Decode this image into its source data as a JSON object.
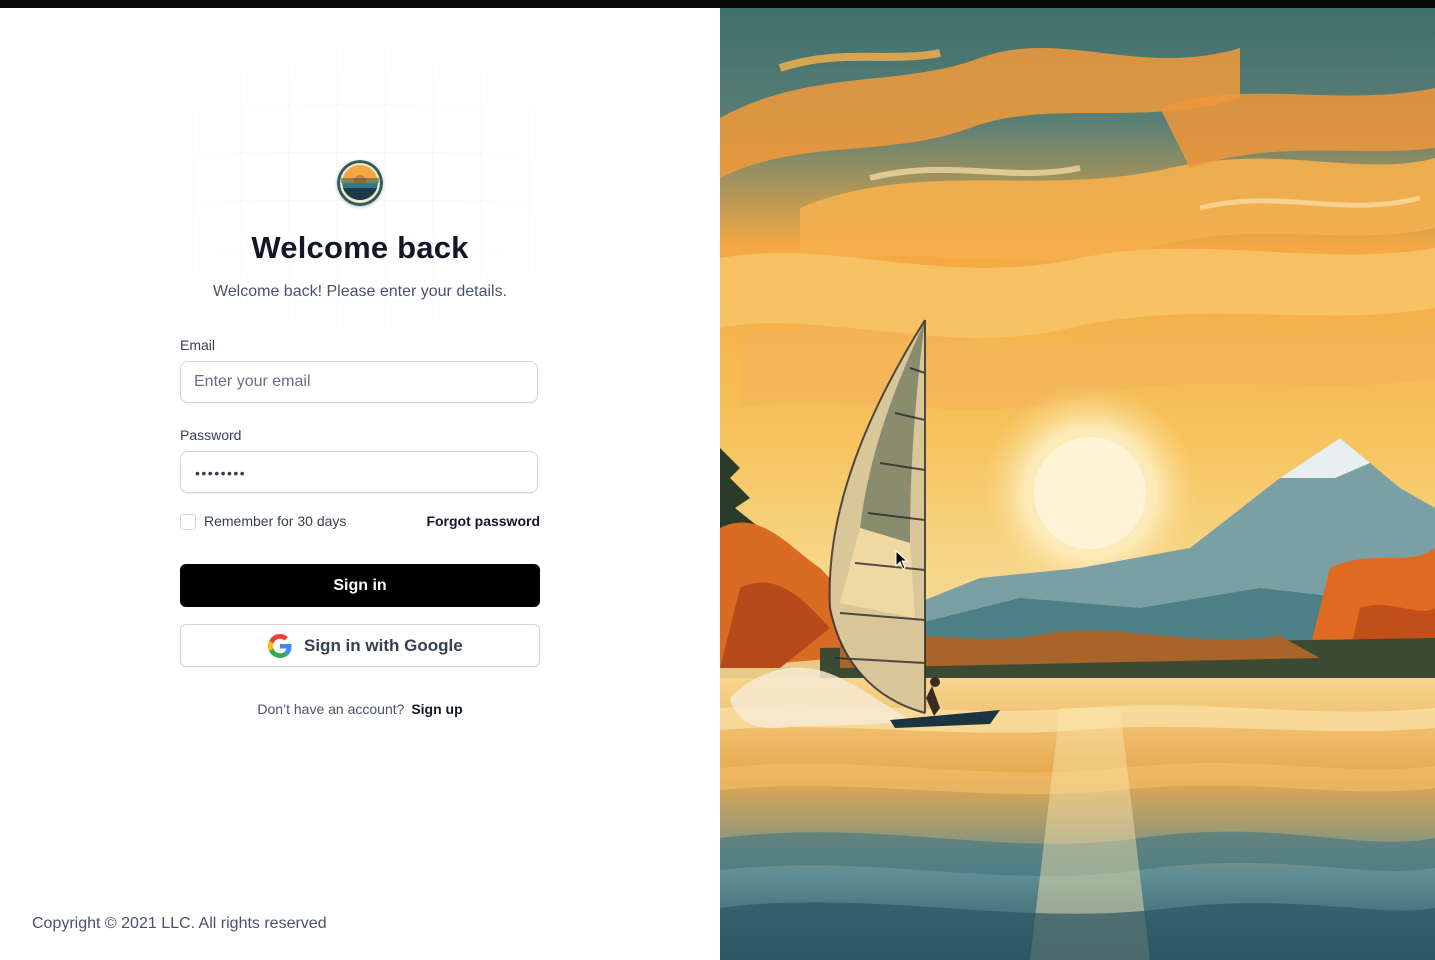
{
  "header": {
    "title": "Welcome back",
    "subtitle": "Welcome back! Please enter your details."
  },
  "form": {
    "email_label": "Email",
    "email_placeholder": "Enter your email",
    "email_value": "",
    "password_label": "Password",
    "password_masked": "••••••••",
    "remember_label": "Remember for 30 days",
    "remember_checked": false,
    "forgot_label": "Forgot password",
    "sign_in_label": "Sign in",
    "google_label": "Sign in with Google"
  },
  "signup": {
    "prompt": "Don’t have an account?",
    "link_label": "Sign up"
  },
  "footer": {
    "copyright": "Copyright © 2021 LLC. All rights reserved"
  },
  "colors": {
    "primary_button": "#000000",
    "text_dark": "#101828",
    "text_muted": "#475467",
    "border": "#d0d5dd"
  },
  "icons": {
    "logo": "logo-badge",
    "google": "google-g-icon",
    "hero": "windsurfer-sunset-illustration"
  }
}
